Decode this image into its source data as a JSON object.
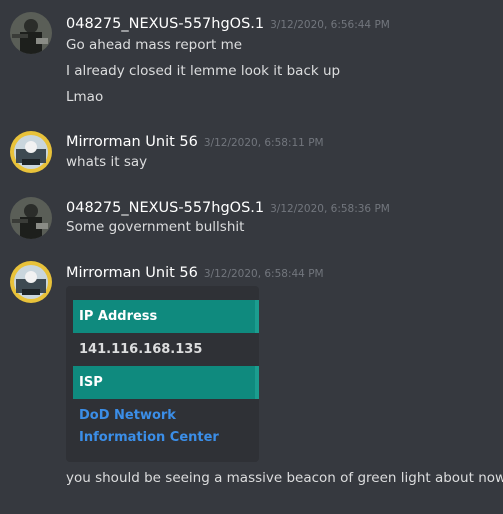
{
  "messages": [
    {
      "username": "048275_NEXUS-557hgOS.1",
      "timestamp": "3/12/2020, 6:56:44 PM",
      "lines": [
        "Go ahead mass report me",
        "I already closed it lemme look it back up",
        "Lmao"
      ]
    },
    {
      "username": "Mirrorman Unit 56",
      "timestamp": "3/12/2020, 6:58:11 PM",
      "lines": [
        "whats it say"
      ]
    },
    {
      "username": "048275_NEXUS-557hgOS.1",
      "timestamp": "3/12/2020, 6:58:36 PM",
      "lines": [
        "Some government bullshit"
      ]
    },
    {
      "username": "Mirrorman Unit 56",
      "timestamp": "3/12/2020, 6:58:44 PM",
      "lines": [
        "you should be seeing a massive beacon of green light about now"
      ]
    }
  ],
  "embed": {
    "ip_label": "IP Address",
    "ip_value": "141.116.168.135",
    "isp_label": "ISP",
    "isp_line1": "DoD Network",
    "isp_line2": "Information Center",
    "accent": "#0f8a7e",
    "link_color": "#3b8ee8"
  },
  "colors": {
    "background": "#36393f",
    "username": "#ffffff",
    "timestamp": "#72767d",
    "text": "#dcddde"
  }
}
